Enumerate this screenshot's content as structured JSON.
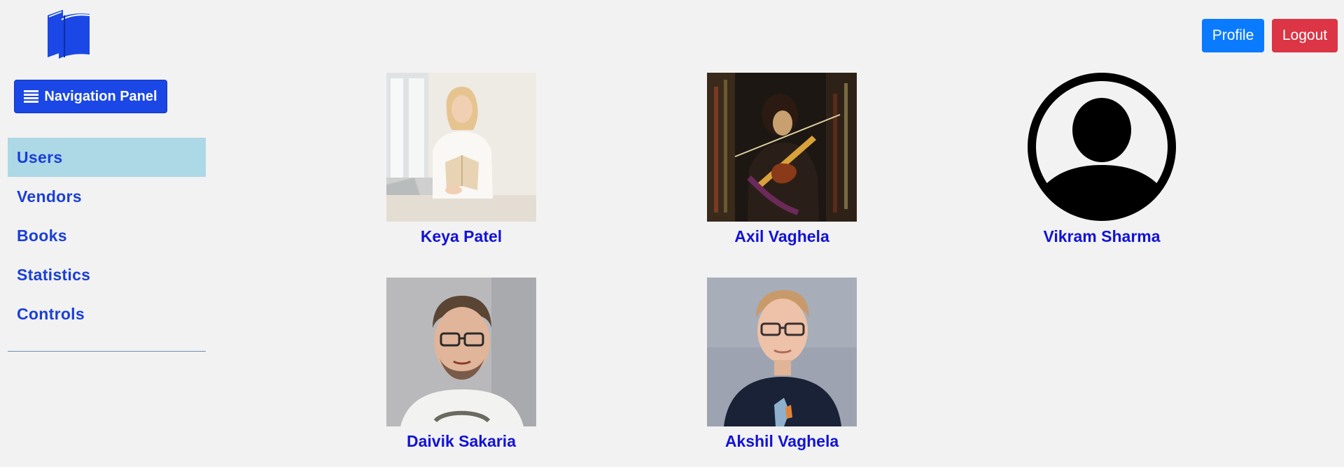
{
  "header": {
    "logo_icon": "books-icon",
    "profile_label": "Profile",
    "logout_label": "Logout"
  },
  "nav_toggle": {
    "icon": "hamburger-icon",
    "label": "Navigation Panel"
  },
  "sidebar": {
    "items": [
      {
        "label": "Users",
        "active": true
      },
      {
        "label": "Vendors",
        "active": false
      },
      {
        "label": "Books",
        "active": false
      },
      {
        "label": "Statistics",
        "active": false
      },
      {
        "label": "Controls",
        "active": false
      }
    ]
  },
  "users": [
    {
      "name": "Keya Patel",
      "photo": "woman-reading-photo"
    },
    {
      "name": "Axil Vaghela",
      "photo": "violinist-painting-photo"
    },
    {
      "name": "Vikram Sharma",
      "photo": "default-avatar-icon"
    },
    {
      "name": "Daivik Sakaria",
      "photo": "man-glasses-photo"
    },
    {
      "name": "Akshil Vaghela",
      "photo": "man-glasses-navy-shirt-photo"
    }
  ],
  "colors": {
    "primary": "#1a47e5",
    "profile": "#0a7bff",
    "logout": "#dc3545",
    "active_bg": "#add8e6",
    "link": "#1212d8"
  }
}
